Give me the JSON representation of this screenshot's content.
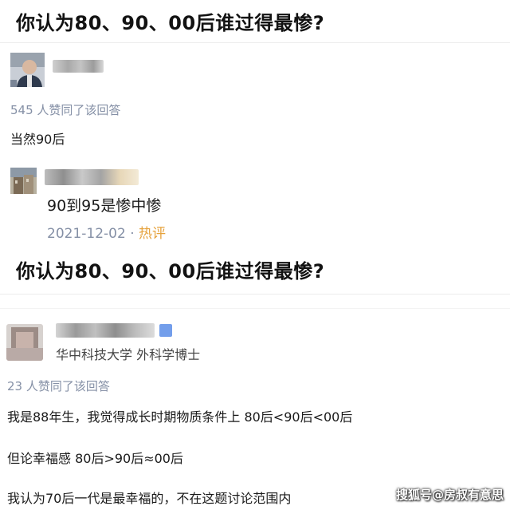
{
  "question_top": {
    "title": "你认为80、90、00后谁过得最惨?"
  },
  "answer_top": {
    "author_icon": "avatar-icon",
    "approval": "545 人赞同了该回答",
    "content": "当然90后",
    "comment": {
      "author_icon": "avatar-icon",
      "text": "90到95是惨中惨",
      "date": "2021-12-02",
      "separator": "·",
      "hot_label": "热评"
    }
  },
  "question_bottom": {
    "title": "你认为80、90、00后谁过得最惨?"
  },
  "answer_bottom": {
    "author_icon": "avatar-icon",
    "author_headline": "华中科技大学 外科学博士",
    "approval": "23 人赞同了该回答",
    "paragraphs": [
      "我是88年生，我觉得成长时期物质条件上 80后<90后<00后",
      "但论幸福感 80后>90后≈00后",
      "我认为70后一代是最幸福的，不在这题讨论范围内"
    ]
  },
  "watermark": {
    "text": "搜狐号@房叔有意思"
  },
  "colors": {
    "meta_gray": "#8590a6",
    "hot_orange": "#e6a23c",
    "title_black": "#121212"
  }
}
